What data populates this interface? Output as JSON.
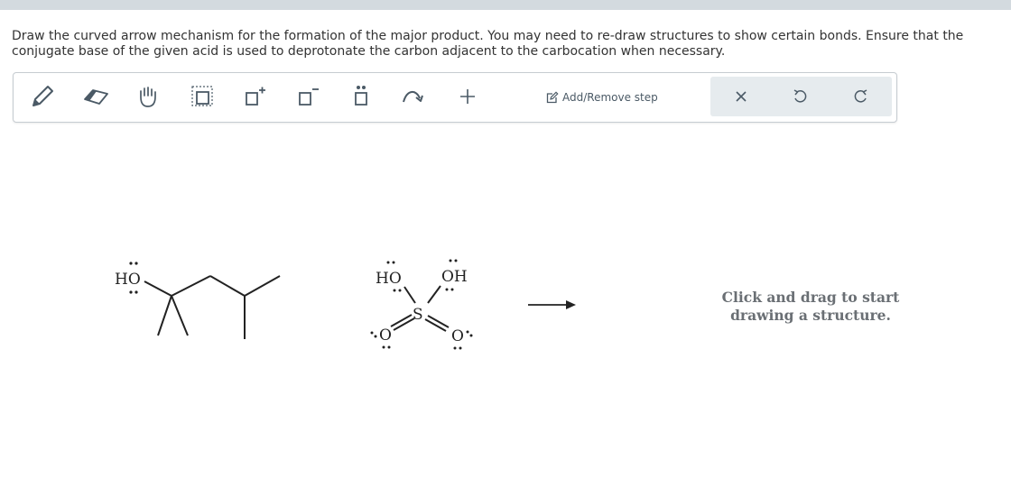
{
  "question": {
    "text": "Draw the curved arrow mechanism for the formation of the major product. You may need to re-draw structures to show certain bonds. Ensure that the conjugate base of the given acid is used to deprotonate the carbon adjacent to the carbocation when necessary."
  },
  "toolbar": {
    "tools": [
      {
        "name": "pencil-icon",
        "label": "Draw"
      },
      {
        "name": "eraser-icon",
        "label": "Erase"
      },
      {
        "name": "hand-icon",
        "label": "Move"
      },
      {
        "name": "select-box-icon",
        "label": "Select"
      },
      {
        "name": "positive-charge-icon",
        "label": "Add positive charge"
      },
      {
        "name": "negative-charge-icon",
        "label": "Add negative charge"
      },
      {
        "name": "lone-pair-icon",
        "label": "Add lone pair"
      },
      {
        "name": "curved-arrow-icon",
        "label": "Curved arrow"
      },
      {
        "name": "plus-icon",
        "label": "Add"
      }
    ],
    "add_remove_step": "Add/Remove step",
    "right_tools": [
      "close-icon",
      "undo-icon",
      "redo-icon"
    ]
  },
  "canvas": {
    "reactant1": {
      "oh_label": "HO"
    },
    "reactant2": {
      "left_label": "HO",
      "right_label": "OH",
      "s_label": "S",
      "o_left": "O",
      "o_right": "O"
    },
    "hint": "Click and drag to start drawing a structure."
  },
  "colors": {
    "topbar": "#d3dadf",
    "text": "#333333",
    "right_group_bg": "#e6ebee",
    "hint_text": "#6a6f74"
  }
}
